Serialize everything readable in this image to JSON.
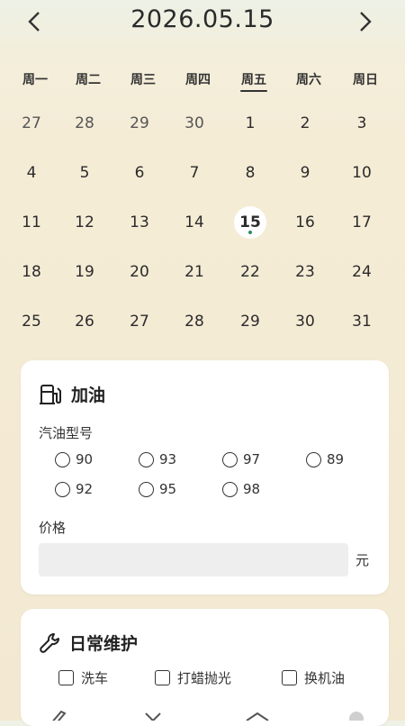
{
  "header": {
    "title": "2026.05.15",
    "prev_icon": "chevron-left-icon",
    "next_icon": "chevron-right-icon"
  },
  "weekdays": [
    "周一",
    "周二",
    "周三",
    "周四",
    "周五",
    "周六",
    "周日"
  ],
  "active_weekday_index": 4,
  "days": [
    {
      "label": "27",
      "other": true
    },
    {
      "label": "28",
      "other": true
    },
    {
      "label": "29",
      "other": true
    },
    {
      "label": "30",
      "other": true
    },
    {
      "label": "1"
    },
    {
      "label": "2"
    },
    {
      "label": "3"
    },
    {
      "label": "4"
    },
    {
      "label": "5"
    },
    {
      "label": "6"
    },
    {
      "label": "7"
    },
    {
      "label": "8"
    },
    {
      "label": "9"
    },
    {
      "label": "10"
    },
    {
      "label": "11"
    },
    {
      "label": "12"
    },
    {
      "label": "13"
    },
    {
      "label": "14"
    },
    {
      "label": "15",
      "today": true
    },
    {
      "label": "16"
    },
    {
      "label": "17"
    },
    {
      "label": "18"
    },
    {
      "label": "19"
    },
    {
      "label": "20"
    },
    {
      "label": "21"
    },
    {
      "label": "22"
    },
    {
      "label": "23"
    },
    {
      "label": "24"
    },
    {
      "label": "25"
    },
    {
      "label": "26"
    },
    {
      "label": "27"
    },
    {
      "label": "28"
    },
    {
      "label": "29"
    },
    {
      "label": "30"
    },
    {
      "label": "31"
    }
  ],
  "fuel": {
    "title": "加油",
    "icon": "fuel-pump-icon",
    "type_label": "汽油型号",
    "options": [
      "90",
      "93",
      "97",
      "89",
      "92",
      "95",
      "98"
    ],
    "price_label": "价格",
    "price_value": "",
    "unit": "元"
  },
  "maintenance": {
    "title": "日常维护",
    "icon": "wrench-icon",
    "items": [
      "洗车",
      "打蜡抛光",
      "换机油"
    ]
  },
  "colors": {
    "accent_dot": "#2e8b57",
    "card_bg": "#ffffff",
    "input_bg": "#eeeeee"
  }
}
